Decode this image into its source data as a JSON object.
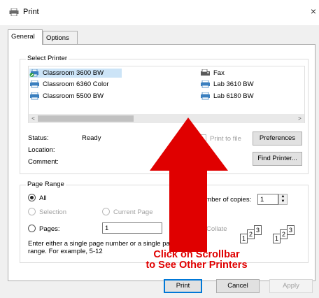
{
  "window": {
    "title": "Print",
    "close_glyph": "×"
  },
  "tabs": [
    {
      "label": "General",
      "active": true
    },
    {
      "label": "Options",
      "active": false
    }
  ],
  "select_printer": {
    "legend": "Select Printer",
    "printers": [
      {
        "name": "Classroom 3600 BW",
        "icon": "printer-default-icon",
        "selected": true
      },
      {
        "name": "Classroom 6360 Color",
        "icon": "printer-icon"
      },
      {
        "name": "Classroom 5500 BW",
        "icon": "printer-icon"
      },
      {
        "name": "Fax",
        "icon": "fax-icon"
      },
      {
        "name": "Lab 3610 BW",
        "icon": "printer-icon"
      },
      {
        "name": "Lab 6180 BW",
        "icon": "printer-icon"
      }
    ],
    "scroll_left": "<",
    "scroll_right": ">"
  },
  "status": {
    "status_label": "Status:",
    "status_value": "Ready",
    "location_label": "Location:",
    "comment_label": "Comment:",
    "print_to_file_label": "Print to file",
    "preferences_button": "Preferences",
    "find_printer_button": "Find Printer..."
  },
  "page_range": {
    "legend": "Page Range",
    "all_label": "All",
    "selection_label": "Selection",
    "current_page_label": "Current Page",
    "pages_label": "Pages:",
    "pages_value": "1",
    "hint": "Enter either a single page number or a single page range.  For example, 5-12"
  },
  "copies": {
    "number_label": "umber of copies:",
    "number_value": "1",
    "collate_label": "Collate",
    "collate_stack_pages": [
      "1",
      "2",
      "3"
    ]
  },
  "buttons": {
    "print": "Print",
    "cancel": "Cancel",
    "apply": "Apply"
  },
  "annotation": {
    "line1": "Click on Scrollbar",
    "line2": "to See Other Printers",
    "color": "#e00000"
  }
}
